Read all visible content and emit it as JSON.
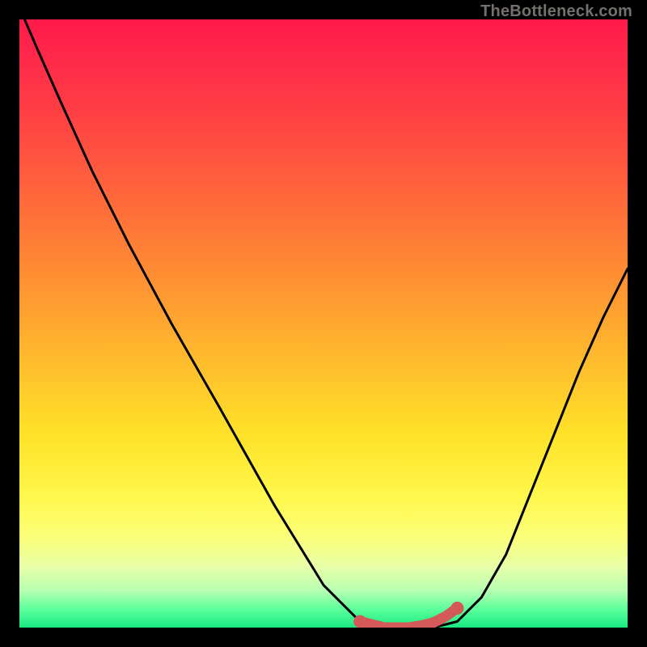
{
  "attribution": "TheBottleneck.com",
  "colors": {
    "frame": "#000000",
    "curve": "#000000",
    "marker": "#d45a5a",
    "gradient_top": "#ff1a4b",
    "gradient_bottom": "#19e883"
  },
  "chart_data": {
    "type": "line",
    "title": "",
    "xlabel": "",
    "ylabel": "",
    "xlim": [
      0,
      100
    ],
    "ylim": [
      0,
      100
    ],
    "series": [
      {
        "name": "bottleneck-curve",
        "x": [
          0,
          3,
          7,
          12,
          18,
          25,
          33,
          42,
          50,
          56,
          60,
          64,
          68,
          72,
          76,
          80,
          84,
          88,
          92,
          96,
          100
        ],
        "values": [
          102,
          95,
          86,
          75,
          63,
          50,
          36,
          20,
          7,
          1,
          0,
          0,
          0,
          1,
          5,
          12,
          22,
          32,
          42,
          51,
          59
        ]
      }
    ],
    "markers": {
      "name": "optimum-range",
      "x": [
        56,
        58,
        60,
        62,
        64,
        66,
        68,
        70,
        72
      ],
      "values": [
        1,
        0.5,
        0,
        0,
        0,
        0.3,
        0.8,
        1.8,
        3.2
      ]
    }
  }
}
